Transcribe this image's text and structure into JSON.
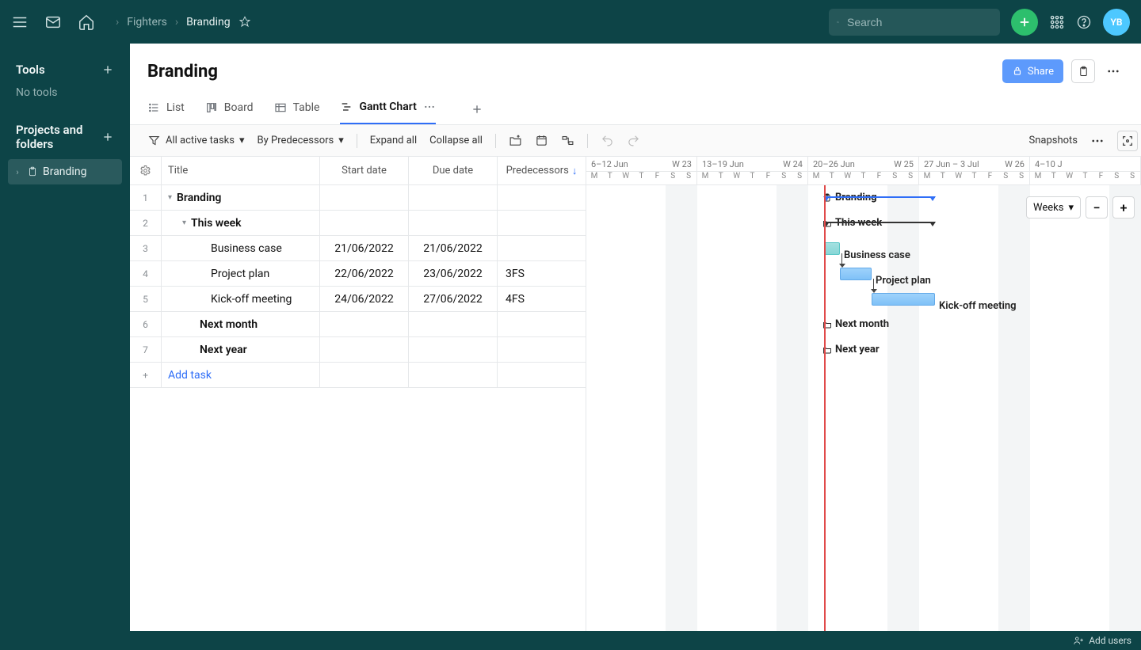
{
  "header": {
    "breadcrumb": [
      "Fighters",
      "Branding"
    ],
    "search_placeholder": "Search",
    "avatar": "YB"
  },
  "sidebar": {
    "tools_header": "Tools",
    "no_tools": "No tools",
    "projects_header": "Projects and folders",
    "project_name": "Branding"
  },
  "page": {
    "title": "Branding",
    "share": "Share"
  },
  "tabs": {
    "list": "List",
    "board": "Board",
    "table": "Table",
    "gantt": "Gantt Chart"
  },
  "toolbar": {
    "filter": "All active tasks",
    "sort": "By Predecessors",
    "expand": "Expand all",
    "collapse": "Collapse all",
    "snapshots": "Snapshots"
  },
  "columns": {
    "title": "Title",
    "start": "Start date",
    "due": "Due date",
    "pred": "Predecessors"
  },
  "rows": [
    {
      "n": "1",
      "title": "Branding",
      "level": 0,
      "group": true,
      "expanded": true,
      "start": "",
      "due": "",
      "pred": ""
    },
    {
      "n": "2",
      "title": "This week",
      "level": 1,
      "group": true,
      "expanded": true,
      "start": "",
      "due": "",
      "pred": ""
    },
    {
      "n": "3",
      "title": "Business case",
      "level": 2,
      "group": false,
      "start": "21/06/2022",
      "due": "21/06/2022",
      "pred": ""
    },
    {
      "n": "4",
      "title": "Project plan",
      "level": 2,
      "group": false,
      "start": "22/06/2022",
      "due": "23/06/2022",
      "pred": "3FS"
    },
    {
      "n": "5",
      "title": "Kick-off meeting",
      "level": 2,
      "group": false,
      "start": "24/06/2022",
      "due": "27/06/2022",
      "pred": "4FS"
    },
    {
      "n": "6",
      "title": "Next month",
      "level": 1,
      "group": true,
      "expanded": false,
      "start": "",
      "due": "",
      "pred": ""
    },
    {
      "n": "7",
      "title": "Next year",
      "level": 1,
      "group": true,
      "expanded": false,
      "start": "",
      "due": "",
      "pred": ""
    }
  ],
  "add_task": "Add task",
  "timeline": {
    "weeks": [
      {
        "range": "6–12 Jun",
        "wk": "W 23"
      },
      {
        "range": "13–19 Jun",
        "wk": "W 24"
      },
      {
        "range": "20–26 Jun",
        "wk": "W 25"
      },
      {
        "range": "27 Jun – 3 Jul",
        "wk": "W 26"
      },
      {
        "range": "4–10 J",
        "wk": ""
      }
    ],
    "days": [
      "M",
      "T",
      "W",
      "T",
      "F",
      "S",
      "S"
    ],
    "zoom": "Weeks"
  },
  "gantt_labels": {
    "branding": "Branding",
    "this_week": "This week",
    "business": "Business case",
    "plan": "Project plan",
    "kickoff": "Kick-off meeting",
    "next_month": "Next month",
    "next_year": "Next year"
  },
  "footer": {
    "add_users": "Add users"
  }
}
